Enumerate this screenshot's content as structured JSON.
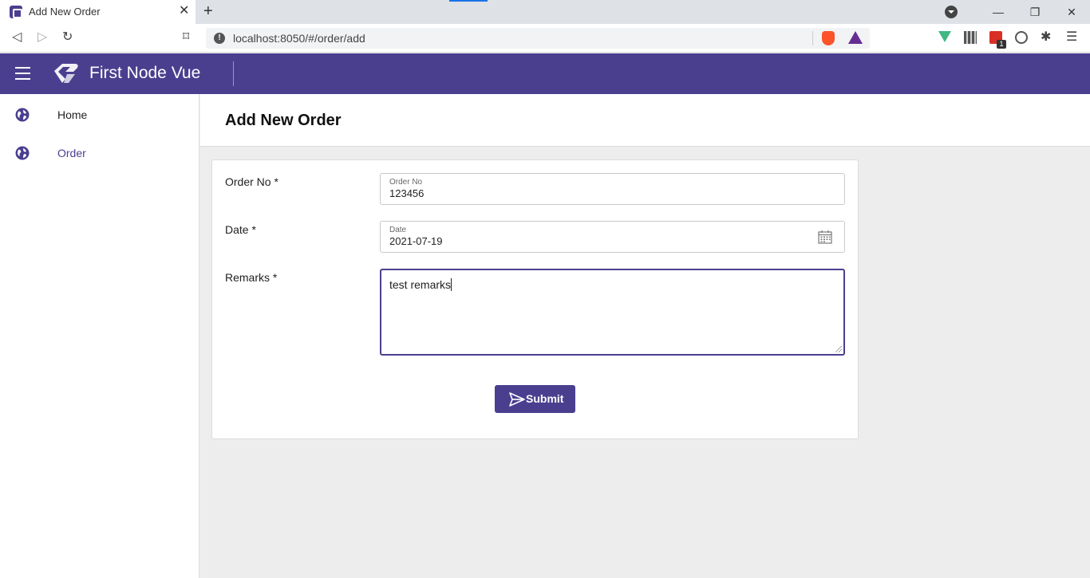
{
  "browser": {
    "tab_title": "Add New Order",
    "tab_close": "✕",
    "new_tab": "+",
    "url": "localhost:8050/#/order/add",
    "back": "◁",
    "forward": "▷",
    "reload": "↻",
    "bookmark": "⌑",
    "minimize": "—",
    "restore": "❐",
    "close": "✕",
    "extension_badge": "1",
    "puzzle": "✱",
    "menu": "☰"
  },
  "app": {
    "title": "First Node Vue",
    "accent_color": "#4a3f8f"
  },
  "sidebar": {
    "items": [
      {
        "label": "Home",
        "icon": "globe-icon",
        "active": false
      },
      {
        "label": "Order",
        "icon": "globe-icon",
        "active": true
      }
    ]
  },
  "page": {
    "title": "Add New Order"
  },
  "form": {
    "order_no": {
      "label": "Order No *",
      "float_label": "Order No",
      "value": "123456"
    },
    "date": {
      "label": "Date *",
      "float_label": "Date",
      "value": "2021-07-19"
    },
    "remarks": {
      "label": "Remarks *",
      "value": "test remarks"
    },
    "submit_label": "Submit"
  }
}
